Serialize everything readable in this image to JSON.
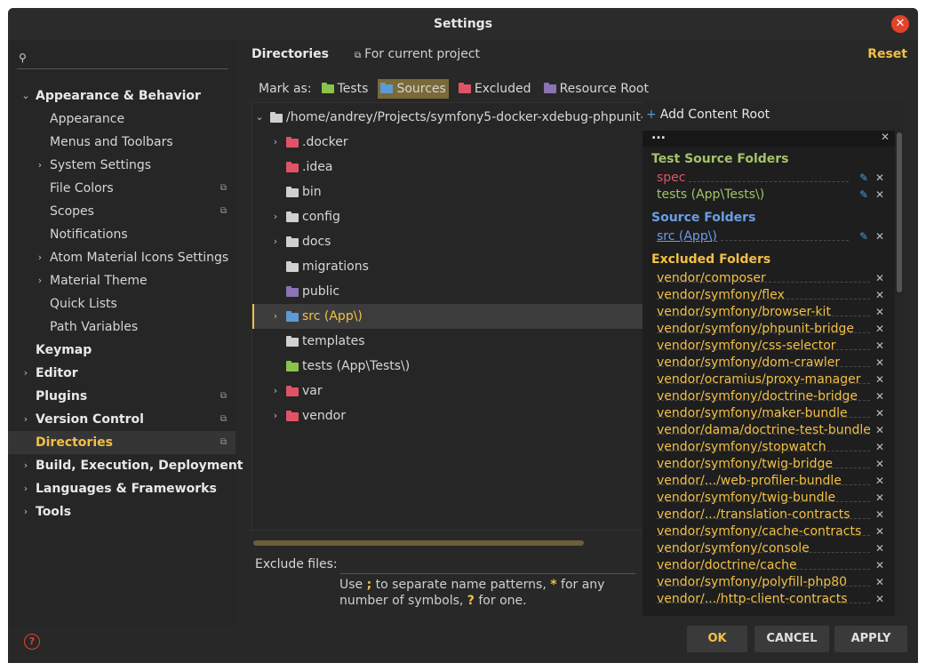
{
  "window": {
    "title": "Settings"
  },
  "search": {
    "placeholder": ""
  },
  "nav": {
    "items": [
      {
        "label": "Appearance & Behavior"
      },
      {
        "label": "Appearance"
      },
      {
        "label": "Menus and Toolbars"
      },
      {
        "label": "System Settings"
      },
      {
        "label": "File Colors"
      },
      {
        "label": "Scopes"
      },
      {
        "label": "Notifications"
      },
      {
        "label": "Atom Material Icons Settings"
      },
      {
        "label": "Material Theme"
      },
      {
        "label": "Quick Lists"
      },
      {
        "label": "Path Variables"
      },
      {
        "label": "Keymap"
      },
      {
        "label": "Editor"
      },
      {
        "label": "Plugins"
      },
      {
        "label": "Version Control"
      },
      {
        "label": "Directories"
      },
      {
        "label": "Build, Execution, Deployment"
      },
      {
        "label": "Languages & Frameworks"
      },
      {
        "label": "Tools"
      }
    ]
  },
  "header": {
    "title": "Directories",
    "project": "For current project",
    "reset": "Reset"
  },
  "markas": {
    "label": "Mark as:",
    "options": [
      {
        "label": "Tests",
        "color": "#8bc34a"
      },
      {
        "label": "Sources",
        "color": "#5b9bd5"
      },
      {
        "label": "Excluded",
        "color": "#e05366"
      },
      {
        "label": "Resource Root",
        "color": "#8b73b5"
      }
    ]
  },
  "tree": {
    "root": "/home/andrey/Projects/symfony5-docker-xdebug-phpunit-",
    "items": [
      {
        "label": ".docker",
        "color": "#e05366"
      },
      {
        "label": ".idea",
        "color": "#e05366"
      },
      {
        "label": "bin",
        "color": "#d0d0d0"
      },
      {
        "label": "config",
        "color": "#d0d0d0"
      },
      {
        "label": "docs",
        "color": "#d0d0d0"
      },
      {
        "label": "migrations",
        "color": "#d0d0d0"
      },
      {
        "label": "public",
        "color": "#8b73b5"
      },
      {
        "label": "src (App\\)",
        "color": "#5b9bd5"
      },
      {
        "label": "templates",
        "color": "#d0d0d0"
      },
      {
        "label": "tests (App\\Tests\\)",
        "color": "#8bc34a"
      },
      {
        "label": "var",
        "color": "#e05366"
      },
      {
        "label": "vendor",
        "color": "#e05366"
      }
    ]
  },
  "exclude": {
    "label": "Exclude files:",
    "hint_use": "Use",
    "hint_sep": ";",
    "hint_mid": "to separate name patterns,",
    "hint_star": "*",
    "hint_end": "for any",
    "hint_line2a": "number of symbols,",
    "hint_q": "?",
    "hint_line2b": "for one."
  },
  "roots": {
    "add_label": "Add Content Root",
    "dots": "...",
    "test_title": "Test Source Folders",
    "tests": [
      "spec",
      "tests (App\\Tests\\)"
    ],
    "source_title": "Source Folders",
    "sources": [
      "src (App\\)"
    ],
    "excluded_title": "Excluded Folders",
    "excluded": [
      "vendor/composer",
      "vendor/symfony/flex",
      "vendor/symfony/browser-kit",
      "vendor/symfony/phpunit-bridge",
      "vendor/symfony/css-selector",
      "vendor/symfony/dom-crawler",
      "vendor/ocramius/proxy-manager",
      "vendor/symfony/doctrine-bridge",
      "vendor/symfony/maker-bundle",
      "vendor/dama/doctrine-test-bundle",
      "vendor/symfony/stopwatch",
      "vendor/symfony/twig-bridge",
      "vendor/.../web-profiler-bundle",
      "vendor/symfony/twig-bundle",
      "vendor/.../translation-contracts",
      "vendor/symfony/cache-contracts",
      "vendor/symfony/console",
      "vendor/doctrine/cache",
      "vendor/symfony/polyfill-php80",
      "vendor/.../http-client-contracts"
    ]
  },
  "buttons": {
    "ok": "OK",
    "cancel": "CANCEL",
    "apply": "APPLY"
  },
  "colors": {
    "accent": "#f2c046",
    "test": "#a5c26a",
    "test_spec": "#e05366",
    "source": "#6a9ee8",
    "excluded": "#f2c046"
  }
}
